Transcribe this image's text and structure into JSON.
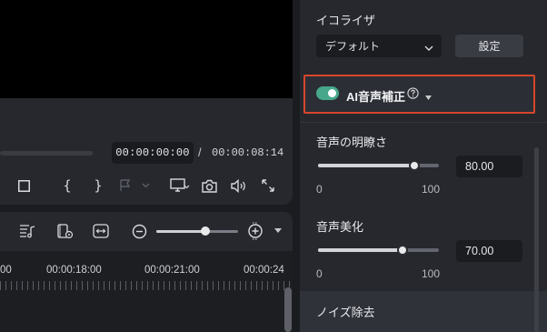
{
  "player": {
    "current_time": "00:00:00:00",
    "separator": "/",
    "total_time": "00:00:08:14",
    "controls": [
      "stop-icon",
      "mark-in-icon",
      "mark-out-icon",
      "marker-icon",
      "display-icon",
      "snapshot-icon",
      "volume-icon",
      "fullscreen-icon"
    ]
  },
  "toolbar": {
    "icons": [
      "audio-list-icon",
      "render-preview-icon",
      "fit-icon",
      "zoom-out-icon",
      "zoom-in-icon"
    ],
    "zoom_level": 0.6
  },
  "timeline": {
    "ruler_labels": [
      "00",
      "00:00:18:00",
      "00:00:21:00",
      "00:00:24"
    ]
  },
  "panel": {
    "equalizer": {
      "title": "イコライザ",
      "selected": "デフォルト",
      "settings_label": "設定"
    },
    "ai_enhance": {
      "label": "AI音声補正",
      "enabled": true,
      "accent": "#46a78a",
      "highlight": "#d8462a"
    },
    "clarity": {
      "label": "音声の明瞭さ",
      "value": "80.00",
      "min": "0",
      "max": "100"
    },
    "beautify": {
      "label": "音声美化",
      "value": "70.00",
      "min": "0",
      "max": "100"
    },
    "noise_removal": {
      "label": "ノイズ除去"
    }
  }
}
